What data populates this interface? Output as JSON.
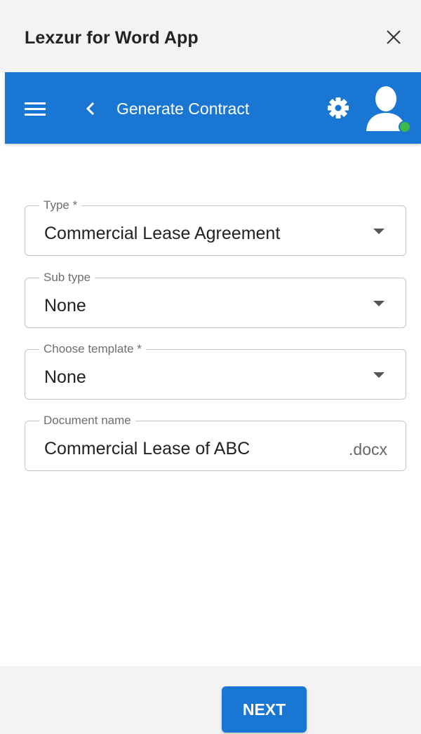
{
  "window": {
    "title": "Lexzur for Word App",
    "close_icon": "close-icon"
  },
  "appbar": {
    "title": "Generate Contract",
    "menu_icon": "hamburger-menu-icon",
    "back_icon": "chevron-left-icon",
    "settings_icon": "gear-icon",
    "avatar_icon": "user-avatar-icon",
    "status_color": "#3fb84a",
    "background": "#1976d2"
  },
  "form": {
    "type": {
      "label": "Type *",
      "value": "Commercial Lease Agreement"
    },
    "subtype": {
      "label": "Sub type",
      "value": "None"
    },
    "template": {
      "label": "Choose template *",
      "value": "None"
    },
    "document_name": {
      "label": "Document name",
      "value": "Commercial Lease of ABC",
      "suffix": ".docx"
    }
  },
  "footer": {
    "next_label": "NEXT"
  }
}
